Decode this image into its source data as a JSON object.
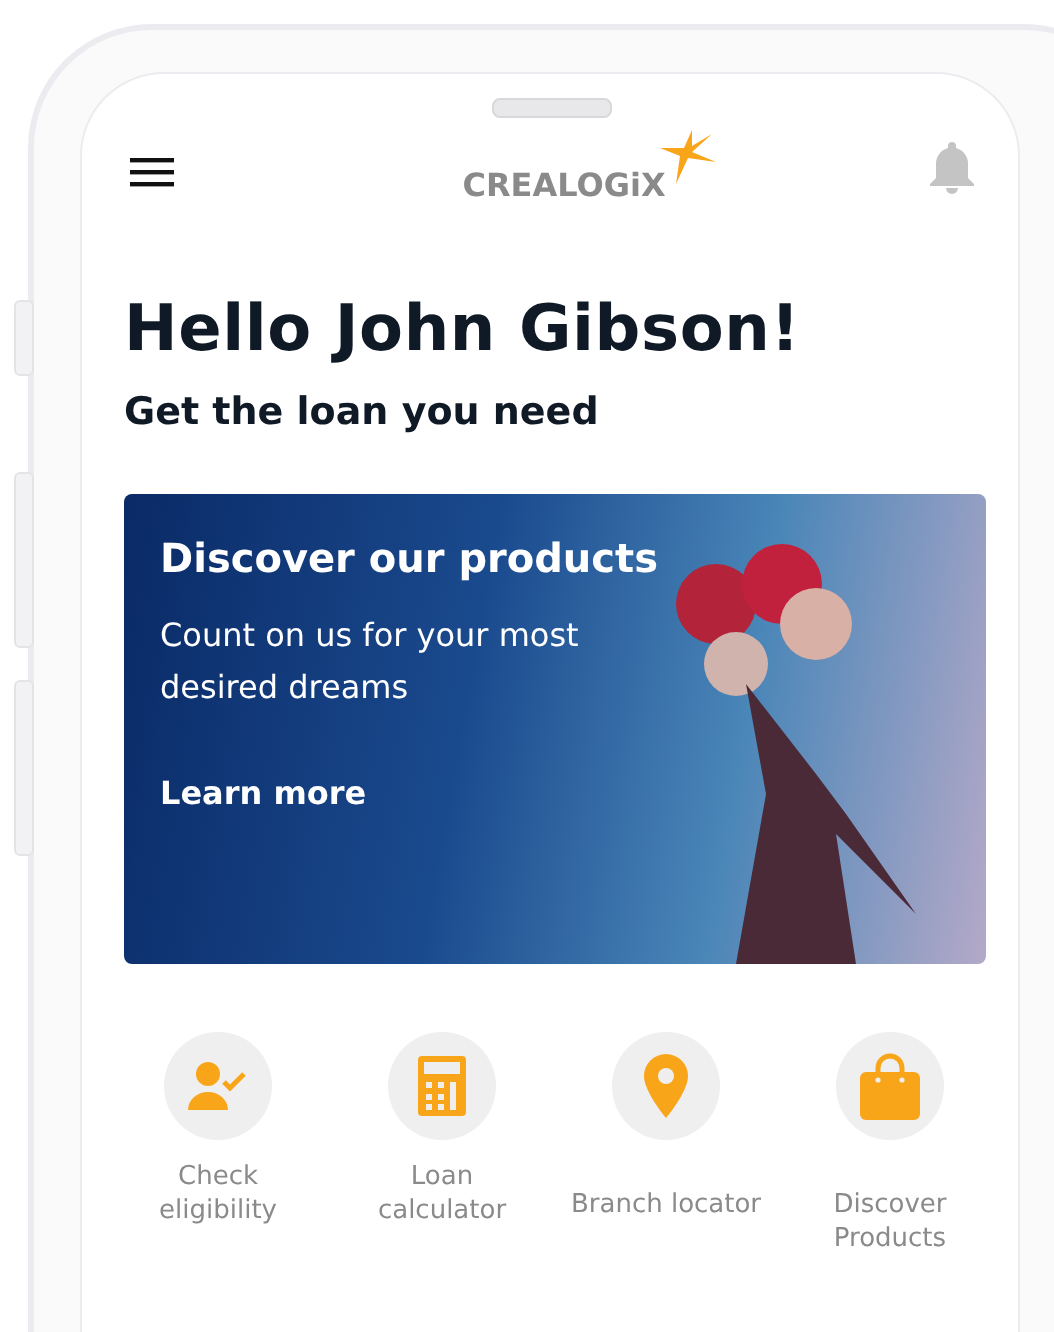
{
  "header": {
    "logo": "CREALOGiX"
  },
  "greeting": {
    "title": "Hello John Gibson!",
    "subtitle": "Get the loan you need"
  },
  "banner": {
    "title": "Discover our products",
    "text": "Count on us for your most desired dreams",
    "link": "Learn more"
  },
  "actions": [
    {
      "kind": "eligibility",
      "label": "Check eligibility"
    },
    {
      "kind": "calculator",
      "label": "Loan calculator"
    },
    {
      "kind": "location",
      "label": "Branch locator"
    },
    {
      "kind": "shopping",
      "label": "Discover Products"
    }
  ]
}
